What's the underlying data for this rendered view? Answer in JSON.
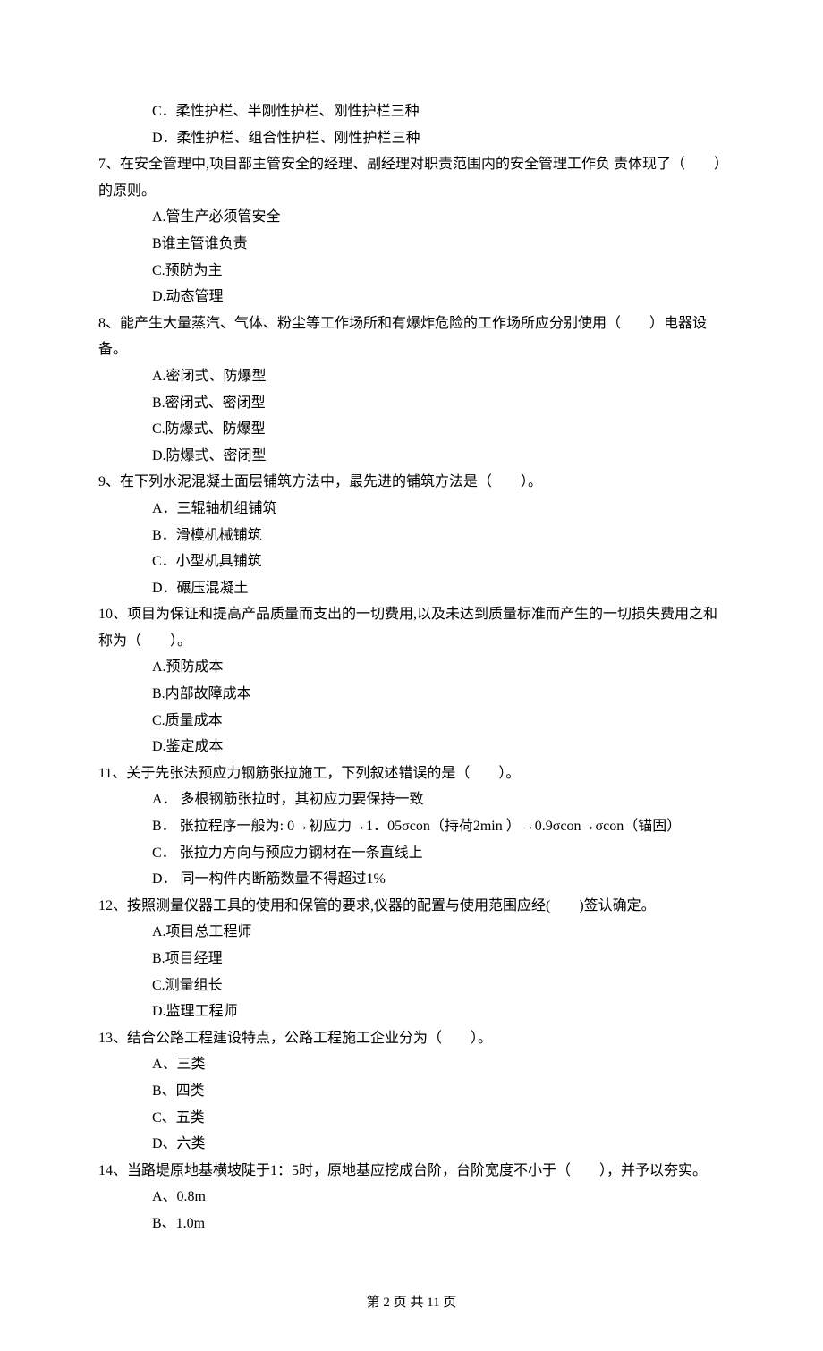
{
  "partial_q6": {
    "opt_c": "C．柔性护栏、半刚性护栏、刚性护栏三种",
    "opt_d": "D．柔性护栏、组合性护栏、刚性护栏三种"
  },
  "q7": {
    "text": "7、在安全管理中,项目部主管安全的经理、副经理对职责范围内的安全管理工作负 责体现了（　　）的原则。",
    "a": "A.管生产必须管安全",
    "b": "B谁主管谁负责",
    "c": "C.预防为主",
    "d": "D.动态管理"
  },
  "q8": {
    "text": "8、能产生大量蒸汽、气体、粉尘等工作场所和有爆炸危险的工作场所应分别使用（　　）电器设备。",
    "a": "A.密闭式、防爆型",
    "b": "B.密闭式、密闭型",
    "c": "C.防爆式、防爆型",
    "d": "D.防爆式、密闭型"
  },
  "q9": {
    "text": "9、在下列水泥混凝土面层铺筑方法中，最先进的铺筑方法是（　　）。",
    "a": "A．三辊轴机组铺筑",
    "b": "B．滑模机械铺筑",
    "c": "C．小型机具铺筑",
    "d": "D．碾压混凝土"
  },
  "q10": {
    "text": "10、项目为保证和提高产品质量而支出的一切费用,以及未达到质量标准而产生的一切损失费用之和称为（　　）。",
    "a": "A.预防成本",
    "b": "B.内部故障成本",
    "c": "C.质量成本",
    "d": "D.鉴定成本"
  },
  "q11": {
    "text": "11、关于先张法预应力钢筋张拉施工，下列叙述错误的是（　　）。",
    "a": "A． 多根钢筋张拉时，其初应力要保持一致",
    "b": "B． 张拉程序一般为: 0→初应力→1．05σcon（持荷2min ）→0.9σcon→σcon（锚固）",
    "c": "C． 张拉力方向与预应力钢材在一条直线上",
    "d": "D． 同一构件内断筋数量不得超过1%"
  },
  "q12": {
    "text": "12、按照测量仪器工具的使用和保管的要求,仪器的配置与使用范围应经(　　)签认确定。",
    "a": "A.项目总工程师",
    "b": "B.项目经理",
    "c": "C.测量组长",
    "d": "D.监理工程师"
  },
  "q13": {
    "text": "13、结合公路工程建设特点，公路工程施工企业分为（　　）。",
    "a": "A、三类",
    "b": "B、四类",
    "c": "C、五类",
    "d": "D、六类"
  },
  "q14": {
    "text": "14、当路堤原地基横坡陡于1：5时，原地基应挖成台阶，台阶宽度不小于（　　），并予以夯实。",
    "a": "A、0.8m",
    "b": "B、1.0m"
  },
  "footer": "第 2 页 共 11 页"
}
